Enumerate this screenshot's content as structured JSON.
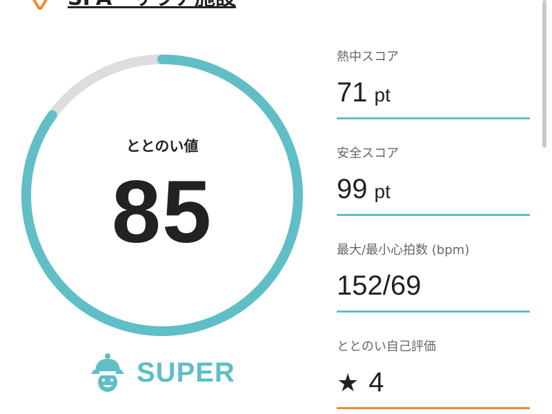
{
  "header": {
    "title": "SPA・サウナ施設"
  },
  "ring": {
    "label": "ととのい値",
    "value": "85",
    "progress": 0.85
  },
  "rank": {
    "label": "SUPER"
  },
  "stats": {
    "heat": {
      "label": "熱中スコア",
      "value": "71",
      "unit": "pt"
    },
    "safety": {
      "label": "安全スコア",
      "value": "99",
      "unit": "pt"
    },
    "heart": {
      "label": "最大/最小心拍数 (bpm)",
      "value": "152/69"
    },
    "self": {
      "label": "ととのい自己評価",
      "star": "★",
      "value": "4"
    }
  },
  "colors": {
    "accent": "#5fbec6",
    "track": "#dddddd",
    "orange": "#f08a33",
    "text": "#222222",
    "label": "#666666"
  }
}
